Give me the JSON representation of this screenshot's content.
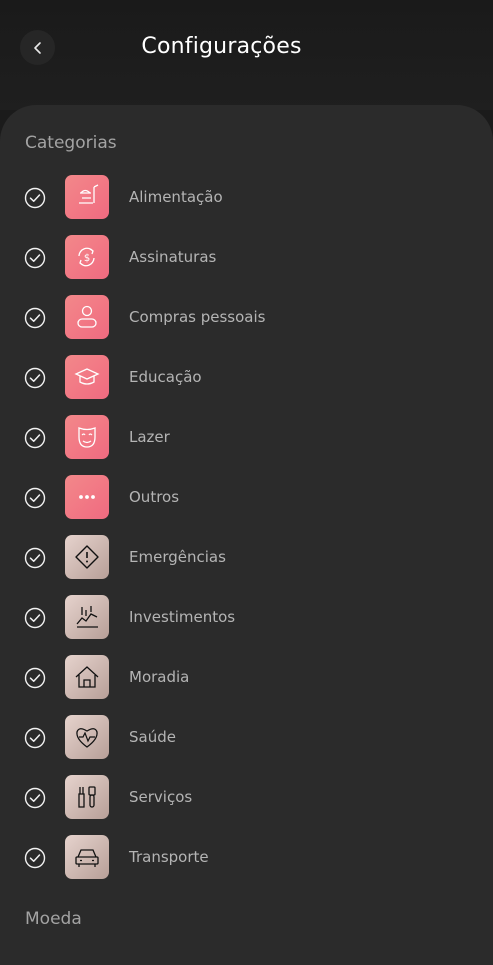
{
  "header": {
    "title": "Configurações"
  },
  "sections": {
    "categories_title": "Categorias",
    "currency_title": "Moeda"
  },
  "categories": [
    {
      "label": "Alimentação",
      "icon": "food-icon",
      "style": "pink"
    },
    {
      "label": "Assinaturas",
      "icon": "subscription-icon",
      "style": "pink"
    },
    {
      "label": "Compras pessoais",
      "icon": "person-icon",
      "style": "pink"
    },
    {
      "label": "Educação",
      "icon": "graduation-cap-icon",
      "style": "pink"
    },
    {
      "label": "Lazer",
      "icon": "mask-icon",
      "style": "pink"
    },
    {
      "label": "Outros",
      "icon": "more-icon",
      "style": "pink"
    },
    {
      "label": "Emergências",
      "icon": "warning-icon",
      "style": "beige"
    },
    {
      "label": "Investimentos",
      "icon": "investment-chart-icon",
      "style": "beige"
    },
    {
      "label": "Moradia",
      "icon": "house-icon",
      "style": "beige"
    },
    {
      "label": "Saúde",
      "icon": "heart-pulse-icon",
      "style": "beige"
    },
    {
      "label": "Serviços",
      "icon": "tools-icon",
      "style": "beige"
    },
    {
      "label": "Transporte",
      "icon": "car-icon",
      "style": "beige"
    }
  ],
  "colors": {
    "accent_pink": "#f07a86",
    "beige": "#cdb8b1",
    "panel": "#2b2b2b"
  }
}
